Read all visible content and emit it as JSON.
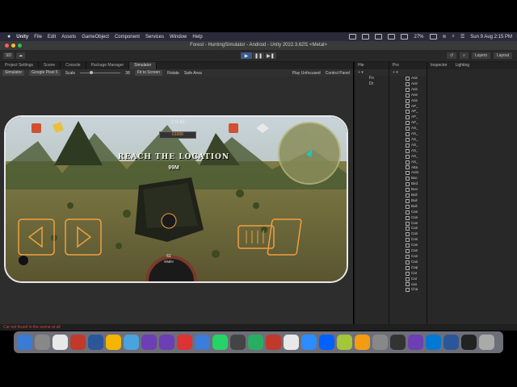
{
  "menubar": {
    "app_name": "Unity",
    "items": [
      "File",
      "Edit",
      "Assets",
      "GameObject",
      "Component",
      "Services",
      "Window",
      "Help"
    ],
    "battery": "27%",
    "clock": "Sun 9 Aug  2:15 PM"
  },
  "window": {
    "title": "Forest - HuntingSimulator - Android - Unity 2022.3.62f1 <Metal>"
  },
  "toolbar": {
    "account_label": "SD",
    "layers_label": "Layers",
    "layout_label": "Layout"
  },
  "tabs": [
    {
      "label": "Project Settings"
    },
    {
      "label": "Scene"
    },
    {
      "label": "Console"
    },
    {
      "label": "Package Manager"
    },
    {
      "label": "Simulator"
    }
  ],
  "simulator_bar": {
    "mode": "Simulator",
    "device": "Google Pixel 5",
    "scale_label": "Scale",
    "scale_value": "38",
    "fit_label": "Fit to Screen",
    "rotate_label": "Rotate",
    "safe_area_label": "Safe Area",
    "play_mode": "Play Unfocused",
    "control_panel_label": "Control Panel"
  },
  "game": {
    "objective": "Reach the location",
    "distance": "99M",
    "score": "01000",
    "speed_value": "61",
    "speed_unit": "KM/H"
  },
  "hierarchy": {
    "tab_label": "Hie",
    "items": [
      "Fo",
      "Dr"
    ]
  },
  "project": {
    "tab_label": "Pro",
    "items": [
      "Anir",
      "Anir",
      "Anir",
      "Anir",
      "Anir",
      "AP_",
      "AP_",
      "AP_",
      "AP_",
      "AS_",
      "AS_",
      "AS_",
      "AS_",
      "AS_",
      "AS_",
      "AS_",
      "Atta",
      "Auto",
      "Bac",
      "Bird",
      "Boo",
      "Buil",
      "Buil",
      "Buil",
      "Can",
      "Can",
      "Can",
      "Can",
      "Can",
      "Can",
      "Can",
      "Can",
      "Can",
      "Can",
      "Cap",
      "Car",
      "Car",
      "cao",
      "Cha"
    ]
  },
  "inspector": {
    "tab_label": "Inspector",
    "lighting_label": "Lighting"
  },
  "statusbar": {
    "message": "Car not found in the scene at all"
  },
  "dock": {
    "apps": [
      {
        "name": "Finder",
        "color": "#3a7bd5"
      },
      {
        "name": "Launchpad",
        "color": "#888"
      },
      {
        "name": "Chrome",
        "color": "#e8e8e8"
      },
      {
        "name": "App",
        "color": "#c0392b"
      },
      {
        "name": "Word",
        "color": "#2b579a"
      },
      {
        "name": "Chrome",
        "color": "#f4b400"
      },
      {
        "name": "Safari",
        "color": "#4aa3df"
      },
      {
        "name": "Visual Studio",
        "color": "#6c3fb4"
      },
      {
        "name": "Visual Studio",
        "color": "#6c3fb4"
      },
      {
        "name": "Git",
        "color": "#d33"
      },
      {
        "name": "MP3",
        "color": "#3b7dd8"
      },
      {
        "name": "WhatsApp",
        "color": "#25d366"
      },
      {
        "name": "Activity",
        "color": "#444"
      },
      {
        "name": "Camtasia",
        "color": "#27ae60"
      },
      {
        "name": "Pinterest",
        "color": "#c0392b"
      },
      {
        "name": "Notes",
        "color": "#e8e8e8"
      },
      {
        "name": "Zoom",
        "color": "#2d8cff"
      },
      {
        "name": "Dropbox",
        "color": "#0061ff"
      },
      {
        "name": "Android",
        "color": "#a4c639"
      },
      {
        "name": "Photos",
        "color": "#f39c12"
      },
      {
        "name": "Mail",
        "color": "#888"
      },
      {
        "name": "Unity",
        "color": "#333"
      },
      {
        "name": "Visual Studio",
        "color": "#6c3fb4"
      },
      {
        "name": "Outlook",
        "color": "#0078d4"
      },
      {
        "name": "Word",
        "color": "#2b579a"
      },
      {
        "name": "Unity",
        "color": "#222"
      },
      {
        "name": "Trash",
        "color": "#aaa"
      }
    ]
  },
  "colors": {
    "menubar_bg": "#2a2a3a",
    "editor_bg": "#2d2d2d",
    "accent_play": "#3a5a8a",
    "hud_orange": "#f0a040"
  }
}
